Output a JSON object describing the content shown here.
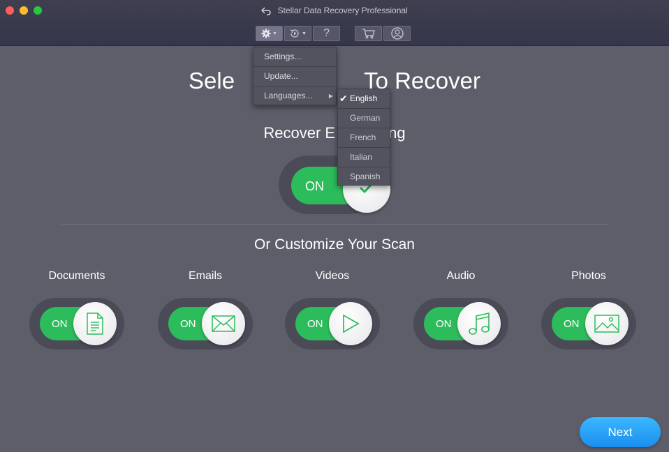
{
  "window": {
    "title": "Stellar Data Recovery Professional"
  },
  "toolbar": {
    "settings_icon": "gear-icon",
    "history_icon": "history-icon",
    "help_label": "?",
    "cart_icon": "cart-icon",
    "account_icon": "user-icon"
  },
  "main": {
    "heading": "Select What To Recover",
    "heading_visible_left": "Sele",
    "heading_visible_right": "To Recover",
    "recover_everything_visible_left": "Recover E",
    "recover_everything_visible_right": "ng",
    "master_toggle": {
      "label": "ON",
      "state": "on"
    },
    "customize_heading": "Or Customize Your Scan",
    "categories": [
      {
        "label": "Documents",
        "toggle": "ON",
        "icon": "document-icon"
      },
      {
        "label": "Emails",
        "toggle": "ON",
        "icon": "envelope-icon"
      },
      {
        "label": "Videos",
        "toggle": "ON",
        "icon": "play-icon"
      },
      {
        "label": "Audio",
        "toggle": "ON",
        "icon": "music-note-icon"
      },
      {
        "label": "Photos",
        "toggle": "ON",
        "icon": "image-icon"
      }
    ],
    "next_label": "Next"
  },
  "settings_menu": {
    "items": [
      {
        "label": "Settings..."
      },
      {
        "label": "Update..."
      },
      {
        "label": "Languages...",
        "has_submenu": true
      }
    ]
  },
  "languages_submenu": {
    "items": [
      {
        "label": "English",
        "selected": true
      },
      {
        "label": "German",
        "selected": false
      },
      {
        "label": "French",
        "selected": false
      },
      {
        "label": "Italian",
        "selected": false
      },
      {
        "label": "Spanish",
        "selected": false
      }
    ],
    "check_glyph": "✔"
  },
  "colors": {
    "toggle_on": "#2dbc5c",
    "next_button": "#1a8ff0",
    "background": "#5d5e6a"
  }
}
